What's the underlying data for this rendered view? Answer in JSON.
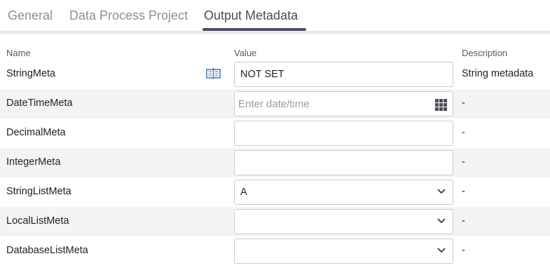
{
  "tabs": [
    {
      "label": "General",
      "active": false
    },
    {
      "label": "Data Process Project",
      "active": false
    },
    {
      "label": "Output Metadata",
      "active": true
    }
  ],
  "columns": {
    "name": "Name",
    "value": "Value",
    "description": "Description"
  },
  "rows": [
    {
      "name": "StringMeta",
      "value": "NOT SET",
      "placeholder": "",
      "control": "text",
      "description": "String metadata",
      "icon": "book-icon"
    },
    {
      "name": "DateTimeMeta",
      "value": "",
      "placeholder": "Enter date/time",
      "control": "datetime",
      "description": "-",
      "icon": "grid-calendar-icon"
    },
    {
      "name": "DecimalMeta",
      "value": "",
      "placeholder": "",
      "control": "text",
      "description": "-"
    },
    {
      "name": "IntegerMeta",
      "value": "",
      "placeholder": "",
      "control": "text",
      "description": "-"
    },
    {
      "name": "StringListMeta",
      "value": "A",
      "placeholder": "",
      "control": "select",
      "description": "-"
    },
    {
      "name": "LocalListMeta",
      "value": "",
      "placeholder": "",
      "control": "select",
      "description": "-"
    },
    {
      "name": "DatabaseListMeta",
      "value": "",
      "placeholder": "",
      "control": "select",
      "description": "-"
    }
  ],
  "colors": {
    "accent": "#4a5160",
    "icon_blue": "#3a7bbf",
    "row_alt": "#f4f4f5",
    "border": "#c9cbd0"
  }
}
